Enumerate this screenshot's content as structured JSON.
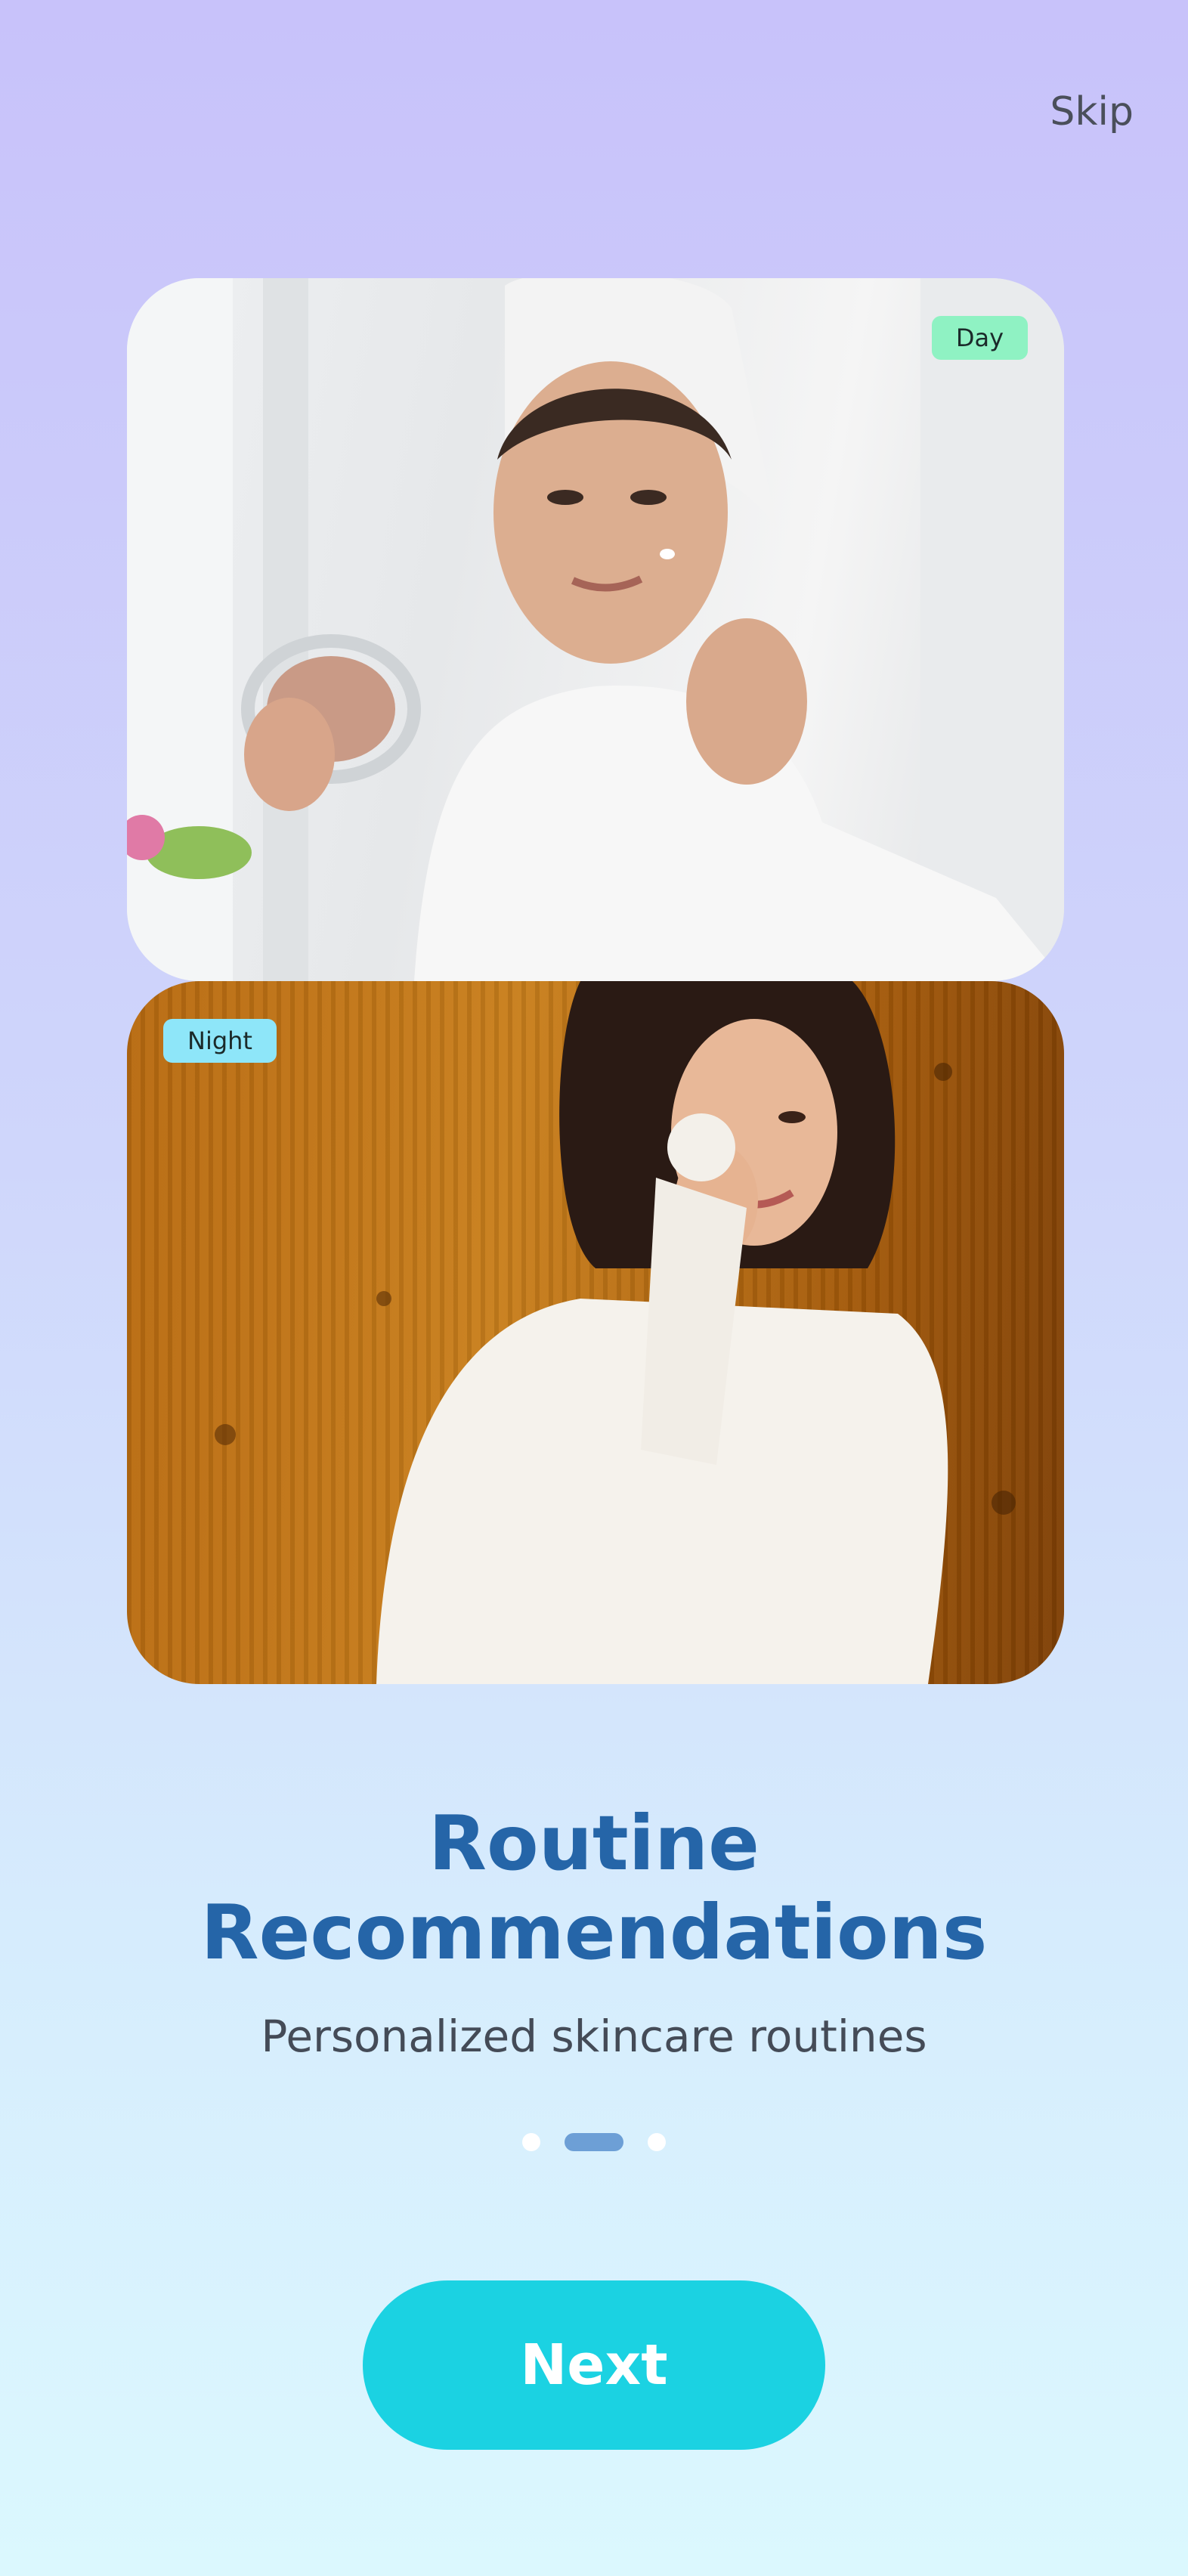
{
  "header": {
    "skip_label": "Skip"
  },
  "photos": {
    "day_tag": "Day",
    "night_tag": "Night"
  },
  "content": {
    "title_line1": "Routine",
    "title_line2": "Recommendations",
    "subtitle": "Personalized skincare routines"
  },
  "pagination": {
    "total": 3,
    "active_index": 1
  },
  "footer": {
    "next_label": "Next"
  },
  "colors": {
    "title": "#2565a8",
    "button": "#1bd2e2",
    "day_tag": "#8ff2c3",
    "night_tag": "#8ee6f9",
    "active_dot": "#6d9fd6"
  }
}
